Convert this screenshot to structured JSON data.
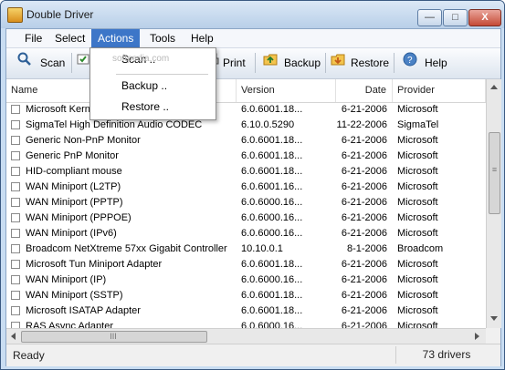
{
  "window": {
    "title": "Double Driver"
  },
  "window_controls": {
    "minimize": "—",
    "maximize": "□",
    "close": "X"
  },
  "menu": {
    "file": "File",
    "select": "Select",
    "actions": "Actions",
    "tools": "Tools",
    "help": "Help"
  },
  "actions_menu": {
    "items": [
      {
        "label": "Scan .."
      },
      {
        "label": "Backup .."
      },
      {
        "label": "Restore .."
      }
    ]
  },
  "toolbar": {
    "scan": "Scan",
    "print": "Print",
    "backup": "Backup",
    "restore": "Restore",
    "help": "Help"
  },
  "grid": {
    "headers": {
      "name": "Name",
      "version": "Version",
      "date": "Date",
      "provider": "Provider"
    },
    "rows": [
      {
        "name": "Microsoft Kernel",
        "version": "6.0.6001.18...",
        "date": "6-21-2006",
        "provider": "Microsoft"
      },
      {
        "name": "SigmaTel High Definition Audio CODEC",
        "version": "6.10.0.5290",
        "date": "11-22-2006",
        "provider": "SigmaTel"
      },
      {
        "name": "Generic Non-PnP Monitor",
        "version": "6.0.6001.18...",
        "date": "6-21-2006",
        "provider": "Microsoft"
      },
      {
        "name": "Generic PnP Monitor",
        "version": "6.0.6001.18...",
        "date": "6-21-2006",
        "provider": "Microsoft"
      },
      {
        "name": "HID-compliant mouse",
        "version": "6.0.6001.18...",
        "date": "6-21-2006",
        "provider": "Microsoft"
      },
      {
        "name": "WAN Miniport (L2TP)",
        "version": "6.0.6001.16...",
        "date": "6-21-2006",
        "provider": "Microsoft"
      },
      {
        "name": "WAN Miniport (PPTP)",
        "version": "6.0.6000.16...",
        "date": "6-21-2006",
        "provider": "Microsoft"
      },
      {
        "name": "WAN Miniport (PPPOE)",
        "version": "6.0.6000.16...",
        "date": "6-21-2006",
        "provider": "Microsoft"
      },
      {
        "name": "WAN Miniport (IPv6)",
        "version": "6.0.6000.16...",
        "date": "6-21-2006",
        "provider": "Microsoft"
      },
      {
        "name": "Broadcom NetXtreme 57xx Gigabit Controller",
        "version": "10.10.0.1",
        "date": "8-1-2006",
        "provider": "Broadcom"
      },
      {
        "name": "Microsoft Tun Miniport Adapter",
        "version": "6.0.6001.18...",
        "date": "6-21-2006",
        "provider": "Microsoft"
      },
      {
        "name": "WAN Miniport (IP)",
        "version": "6.0.6000.16...",
        "date": "6-21-2006",
        "provider": "Microsoft"
      },
      {
        "name": "WAN Miniport (SSTP)",
        "version": "6.0.6001.18...",
        "date": "6-21-2006",
        "provider": "Microsoft"
      },
      {
        "name": "Microsoft ISATAP Adapter",
        "version": "6.0.6001.18...",
        "date": "6-21-2006",
        "provider": "Microsoft"
      },
      {
        "name": "RAS Async Adapter",
        "version": "6.0.6000.16...",
        "date": "6-21-2006",
        "provider": "Microsoft"
      }
    ]
  },
  "scrollbars": {
    "h_grip": "III",
    "v_grip": "≡"
  },
  "status": {
    "left": "Ready",
    "right": "73 drivers"
  },
  "watermark": "softpedia.com",
  "colors": {
    "menu_highlight": "#3d76c8",
    "title_bar": "#c9ddf2",
    "close_button": "#c54a36"
  },
  "icons": [
    "app-icon",
    "scan-icon",
    "select-icon",
    "print-icon",
    "backup-icon",
    "restore-icon",
    "help-icon"
  ]
}
